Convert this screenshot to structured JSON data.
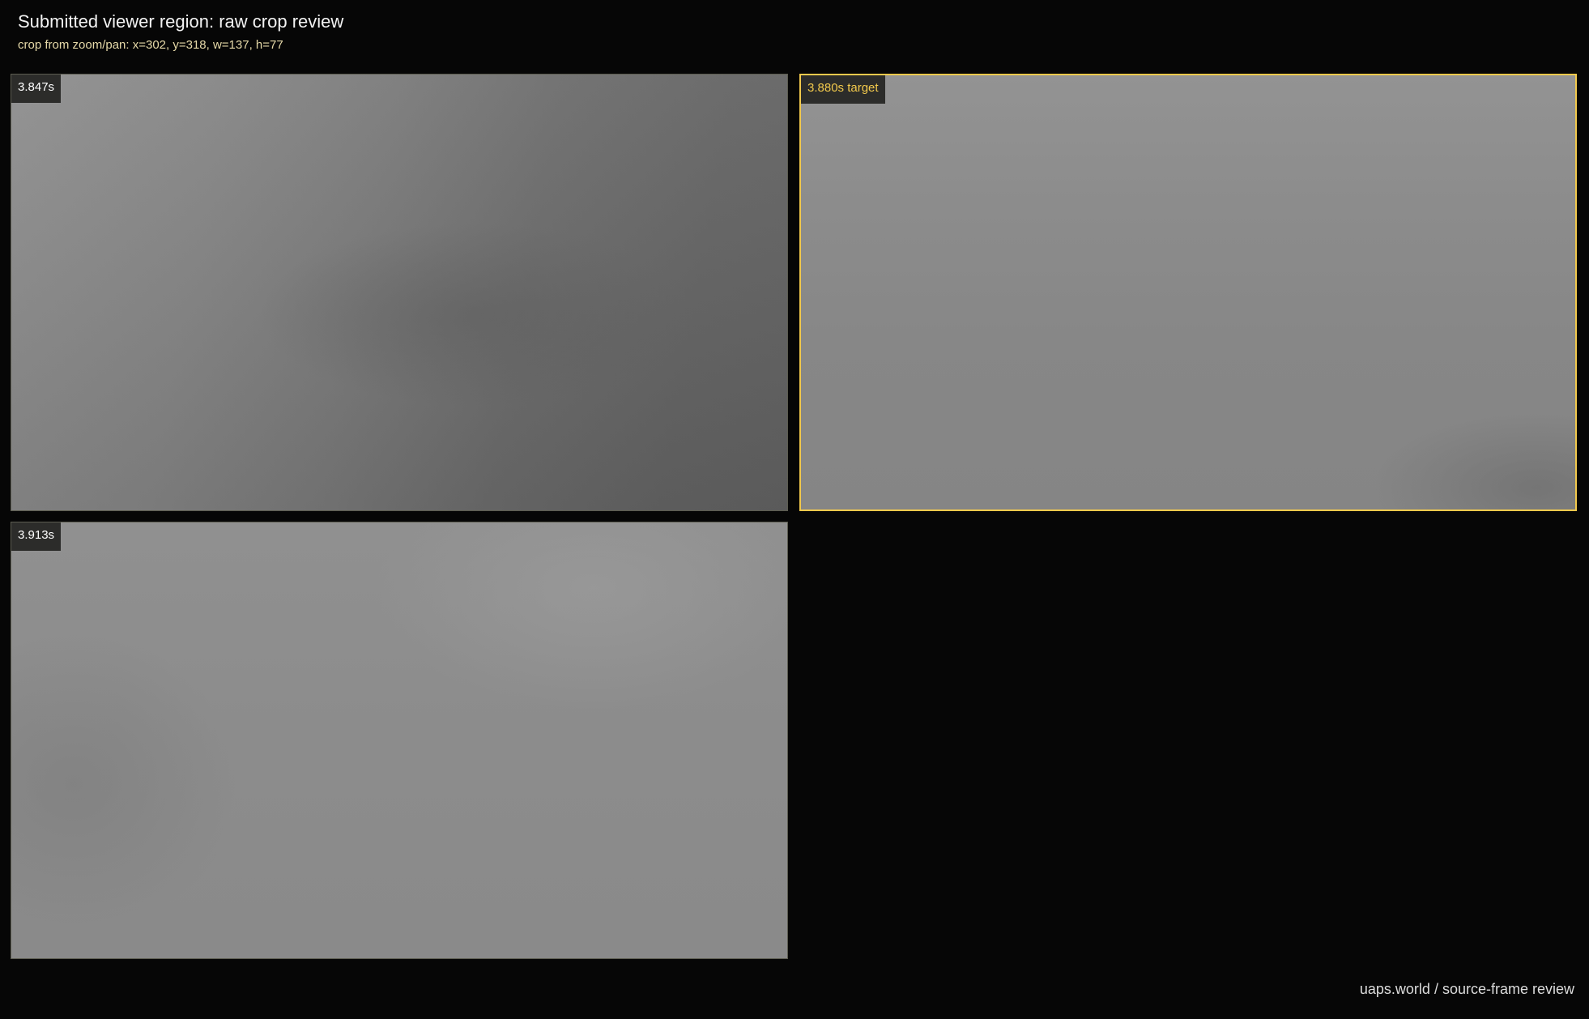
{
  "header": {
    "title": "Submitted viewer region: raw crop review",
    "subtitle": "crop from zoom/pan: x=302, y=318, w=137, h=77"
  },
  "frames": [
    {
      "label": "3.847s",
      "is_target": false
    },
    {
      "label": "3.880s target",
      "is_target": true
    },
    {
      "label": "3.913s",
      "is_target": false
    }
  ],
  "footer": {
    "text": "uaps.world / source-frame review"
  },
  "colors": {
    "background": "#060606",
    "target_highlight": "#f2c94c",
    "label_background": "#2c2c2a"
  }
}
